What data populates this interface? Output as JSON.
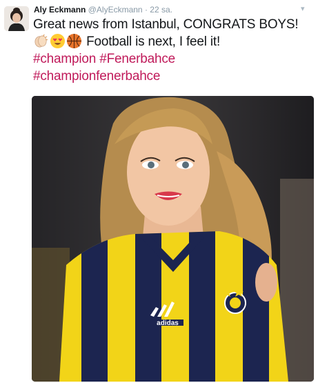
{
  "tweet": {
    "author_name": "Aly Eckmann",
    "handle": "@AlyEckmann",
    "separator": "·",
    "time": "22 sa.",
    "text_part1": "Great news from Istanbul, CONGRATS BOYS! ",
    "text_part2": " Football is next, I feel it!",
    "emojis": [
      "clapping-hands-emoji",
      "heart-eyes-emoji",
      "basketball-emoji"
    ],
    "hashtags": [
      "#champion",
      "#Fenerbahce",
      "#championfenerbahce"
    ],
    "hashtag_color": "#c01a5a"
  },
  "media": {
    "jersey_brand": "adidas",
    "jersey_colors": [
      "#f2d418",
      "#1c2550"
    ]
  }
}
